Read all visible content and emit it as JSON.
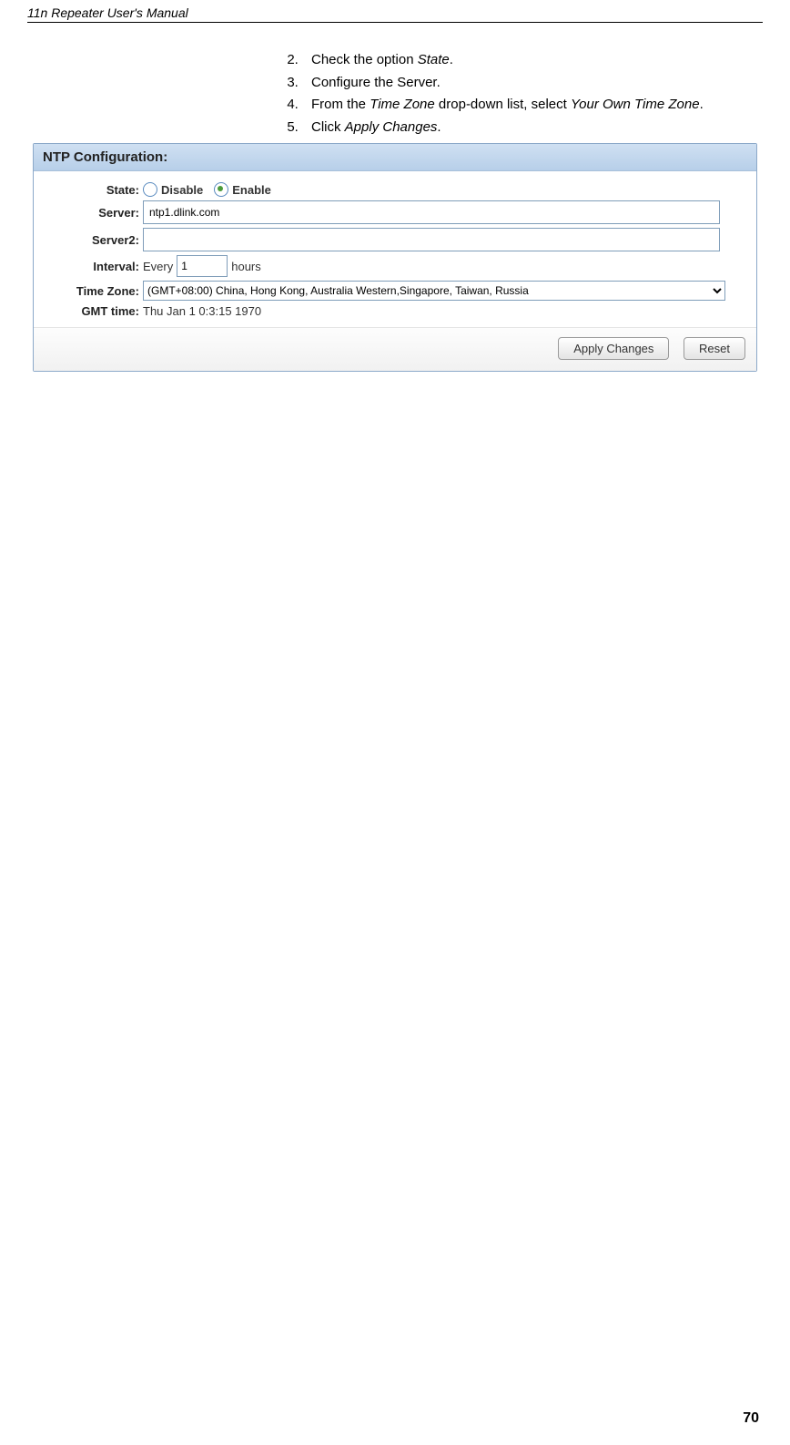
{
  "doc": {
    "header": "11n Repeater User's Manual",
    "page_number": "70"
  },
  "steps": {
    "s2": {
      "pre": "Check the option ",
      "em": "State",
      "post": "."
    },
    "s3": {
      "text": "Configure the Server."
    },
    "s4": {
      "pre": "From the ",
      "em1": "Time Zone",
      "mid": " drop-down list, select ",
      "em2": "Your Own Time Zone",
      "post": "."
    },
    "s5": {
      "pre": "Click ",
      "em": "Apply Changes",
      "post": "."
    }
  },
  "panel": {
    "title": "NTP Configuration:",
    "labels": {
      "state": "State:",
      "server": "Server:",
      "server2": "Server2:",
      "interval": "Interval:",
      "timezone": "Time Zone:",
      "gmt": "GMT time:"
    },
    "state": {
      "disable_label": "Disable",
      "enable_label": "Enable",
      "selected": "enable"
    },
    "server_value": "ntp1.dlink.com",
    "server2_value": "",
    "interval": {
      "prefix": "Every",
      "value": "1",
      "suffix": "hours"
    },
    "timezone_selected": "(GMT+08:00) China, Hong Kong, Australia Western,Singapore, Taiwan, Russia",
    "gmt_value": "Thu Jan 1 0:3:15 1970",
    "buttons": {
      "apply": "Apply Changes",
      "reset": "Reset"
    }
  }
}
